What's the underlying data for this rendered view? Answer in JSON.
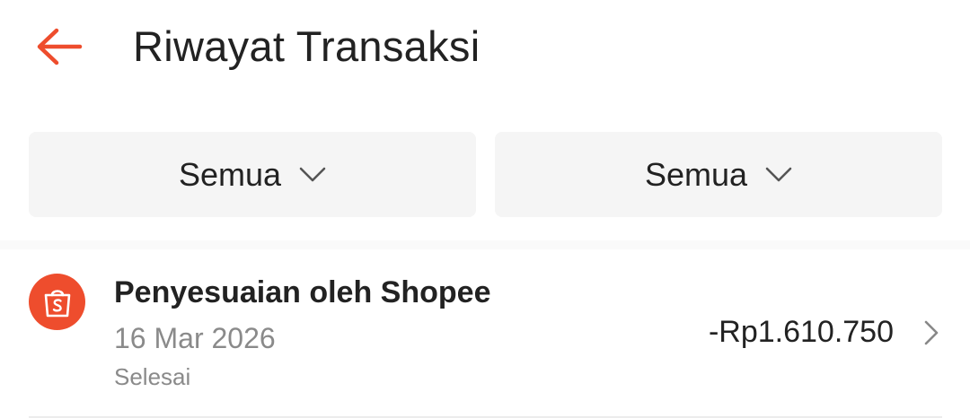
{
  "header": {
    "title": "Riwayat Transaksi",
    "back_icon": "arrow-left-icon"
  },
  "filters": [
    {
      "label": "Semua",
      "icon": "chevron-down-icon"
    },
    {
      "label": "Semua",
      "icon": "chevron-down-icon"
    }
  ],
  "transactions": [
    {
      "icon": "shopee-bag-icon",
      "title": "Penyesuaian oleh Shopee",
      "date": "16 Mar 2026",
      "status": "Selesai",
      "amount": "-Rp1.610.750"
    }
  ],
  "colors": {
    "accent": "#ee4d2d",
    "filter_bg": "#f5f5f5",
    "muted_text": "#8a8a8a",
    "primary_text": "#222222"
  }
}
